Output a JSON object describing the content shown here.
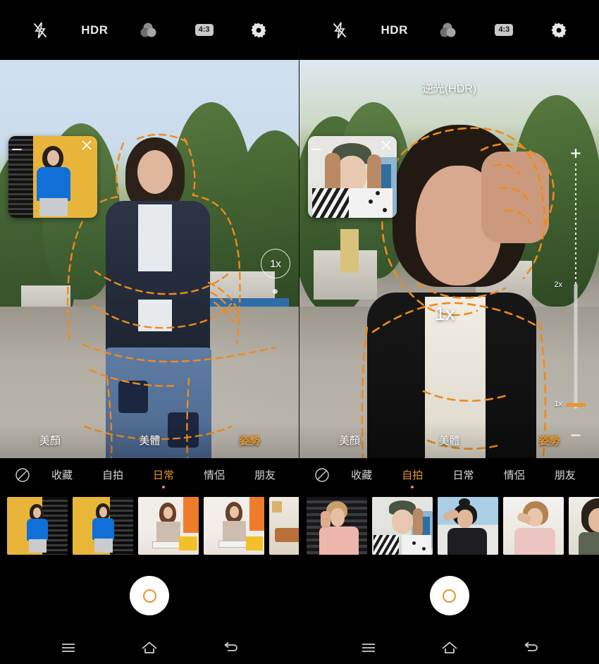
{
  "accent_color": "#E8962A",
  "panels": [
    {
      "id": "left",
      "topbar": {
        "flash": "flash-off",
        "hdr_label": "HDR",
        "filter": "filter-circles",
        "ratio_label": "4:3",
        "settings": "settings-gear"
      },
      "viewfinder": {
        "hdr_note": "",
        "zoom_label": "1x",
        "zoom_style": "circle",
        "reference_card": {
          "close_label": "×",
          "visible": true
        },
        "zoom_slider_visible": false
      },
      "beauty_modes": [
        {
          "label": "美顏",
          "active": false
        },
        {
          "label": "美體",
          "active": false
        },
        {
          "label": "姿勢",
          "active": true
        }
      ],
      "categories": [
        {
          "label": "收藏",
          "active": false
        },
        {
          "label": "自拍",
          "active": false
        },
        {
          "label": "日常",
          "active": true
        },
        {
          "label": "情侶",
          "active": false
        },
        {
          "label": "朋友",
          "active": false
        }
      ],
      "none_icon": "no-filter-icon",
      "thumbnails": [
        {
          "name": "pose-thumb-1",
          "selected": false
        },
        {
          "name": "pose-thumb-2",
          "selected": true
        },
        {
          "name": "pose-thumb-3",
          "selected": false
        },
        {
          "name": "pose-thumb-4",
          "selected": false
        },
        {
          "name": "pose-thumb-5",
          "selected": false
        }
      ],
      "shutter": "shutter-button",
      "navbar": [
        {
          "name": "recents-button",
          "icon": "menu-icon"
        },
        {
          "name": "home-button",
          "icon": "home-icon"
        },
        {
          "name": "back-button",
          "icon": "back-arrow-icon"
        }
      ]
    },
    {
      "id": "right",
      "topbar": {
        "flash": "flash-off",
        "hdr_label": "HDR",
        "filter": "filter-circles",
        "ratio_label": "4:3",
        "settings": "settings-gear"
      },
      "viewfinder": {
        "hdr_note": "逆光(HDR)",
        "zoom_label": "1x",
        "zoom_style": "text",
        "reference_card": {
          "close_label": "×",
          "visible": true
        },
        "zoom_slider_visible": true,
        "zoom_slider": {
          "plus_label": "+",
          "minus_label": "−",
          "max_label": "2x",
          "min_label": "1x",
          "value": "1x"
        }
      },
      "beauty_modes": [
        {
          "label": "美顏",
          "active": false
        },
        {
          "label": "美體",
          "active": false
        },
        {
          "label": "姿勢",
          "active": true
        }
      ],
      "categories": [
        {
          "label": "收藏",
          "active": false
        },
        {
          "label": "自拍",
          "active": true
        },
        {
          "label": "日常",
          "active": false
        },
        {
          "label": "情侶",
          "active": false
        },
        {
          "label": "朋友",
          "active": false
        }
      ],
      "none_icon": "no-filter-icon",
      "thumbnails": [
        {
          "name": "pose-thumb-1",
          "selected": false
        },
        {
          "name": "pose-thumb-2",
          "selected": true
        },
        {
          "name": "pose-thumb-3",
          "selected": false
        },
        {
          "name": "pose-thumb-4",
          "selected": false
        },
        {
          "name": "pose-thumb-5",
          "selected": false
        }
      ],
      "shutter": "shutter-button",
      "navbar": [
        {
          "name": "recents-button",
          "icon": "menu-icon"
        },
        {
          "name": "home-button",
          "icon": "home-icon"
        },
        {
          "name": "back-button",
          "icon": "back-arrow-icon"
        }
      ]
    }
  ]
}
